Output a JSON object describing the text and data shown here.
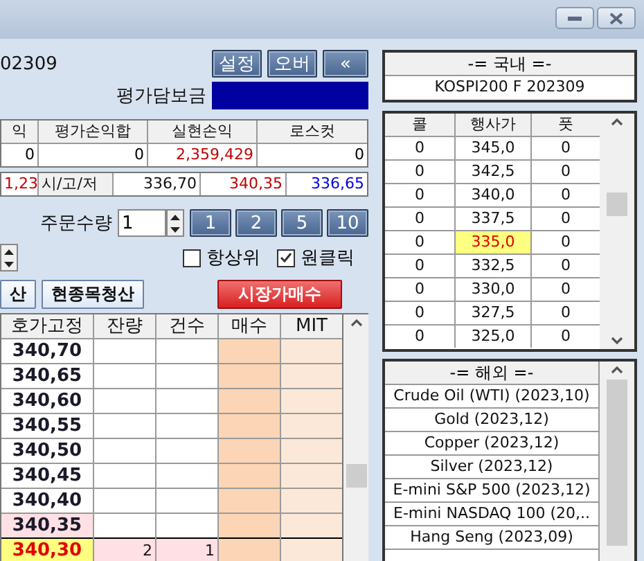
{
  "header": {
    "code": "02309",
    "buttons": [
      "설정",
      "오버",
      "«"
    ],
    "collateral_label": "평가담보금"
  },
  "summary": {
    "columns": [
      "익",
      "평가손익합",
      "실현손익",
      "로스컷"
    ],
    "values": [
      {
        "text": "0",
        "color": "#000000"
      },
      {
        "text": "0",
        "color": "#000000"
      },
      {
        "text": "2,359,429",
        "color": "#c00000"
      },
      {
        "text": "0",
        "color": "#000000"
      }
    ]
  },
  "price_row": {
    "change": "1,23",
    "label": "시/고/저",
    "open": "336,70",
    "high": "340,35",
    "low": "336,65"
  },
  "order_qty": {
    "label": "주문수량",
    "value": "1",
    "presets": [
      "1",
      "2",
      "5",
      "10"
    ]
  },
  "options": [
    {
      "label": "항상위",
      "checked": false
    },
    {
      "label": "원클릭",
      "checked": true
    }
  ],
  "action_buttons": [
    {
      "label": "산",
      "kind": "plain"
    },
    {
      "label": "현종목청산",
      "kind": "plain"
    },
    {
      "label": "시장가매수",
      "kind": "market"
    }
  ],
  "order_book": {
    "columns": [
      "호가고정",
      "잔량",
      "건수",
      "매수",
      "MIT"
    ],
    "rows": [
      {
        "price": "340,70",
        "kind": "normal"
      },
      {
        "price": "340,65",
        "kind": "normal"
      },
      {
        "price": "340,60",
        "kind": "normal"
      },
      {
        "price": "340,55",
        "kind": "normal"
      },
      {
        "price": "340,50",
        "kind": "normal"
      },
      {
        "price": "340,45",
        "kind": "normal"
      },
      {
        "price": "340,40",
        "kind": "normal"
      },
      {
        "price": "340,35",
        "kind": "high"
      },
      {
        "price": "340,30",
        "kind": "current",
        "remaining": "2",
        "count": "1"
      }
    ]
  },
  "domestic": {
    "title": "-= 국내 =-",
    "product": "KOSPI200 F 202309"
  },
  "options_table": {
    "columns": [
      "콜",
      "행사가",
      "풋"
    ],
    "rows": [
      {
        "call": "0",
        "strike": "345,0",
        "put": "0",
        "selected": false
      },
      {
        "call": "0",
        "strike": "342,5",
        "put": "0",
        "selected": false
      },
      {
        "call": "0",
        "strike": "340,0",
        "put": "0",
        "selected": false
      },
      {
        "call": "0",
        "strike": "337,5",
        "put": "0",
        "selected": false
      },
      {
        "call": "0",
        "strike": "335,0",
        "put": "0",
        "selected": true
      },
      {
        "call": "0",
        "strike": "332,5",
        "put": "0",
        "selected": false
      },
      {
        "call": "0",
        "strike": "330,0",
        "put": "0",
        "selected": false
      },
      {
        "call": "0",
        "strike": "327,5",
        "put": "0",
        "selected": false
      },
      {
        "call": "0",
        "strike": "325,0",
        "put": "0",
        "selected": false
      }
    ]
  },
  "overseas": {
    "title": "-= 해외 =-",
    "items": [
      "Crude Oil (WTI) (2023,10)",
      "Gold (2023,12)",
      "Copper (2023,12)",
      "Silver (2023,12)",
      "E-mini S&P 500 (2023,12)",
      "E-mini NASDAQ 100 (20,..",
      "Hang Seng (2023,09)"
    ]
  }
}
